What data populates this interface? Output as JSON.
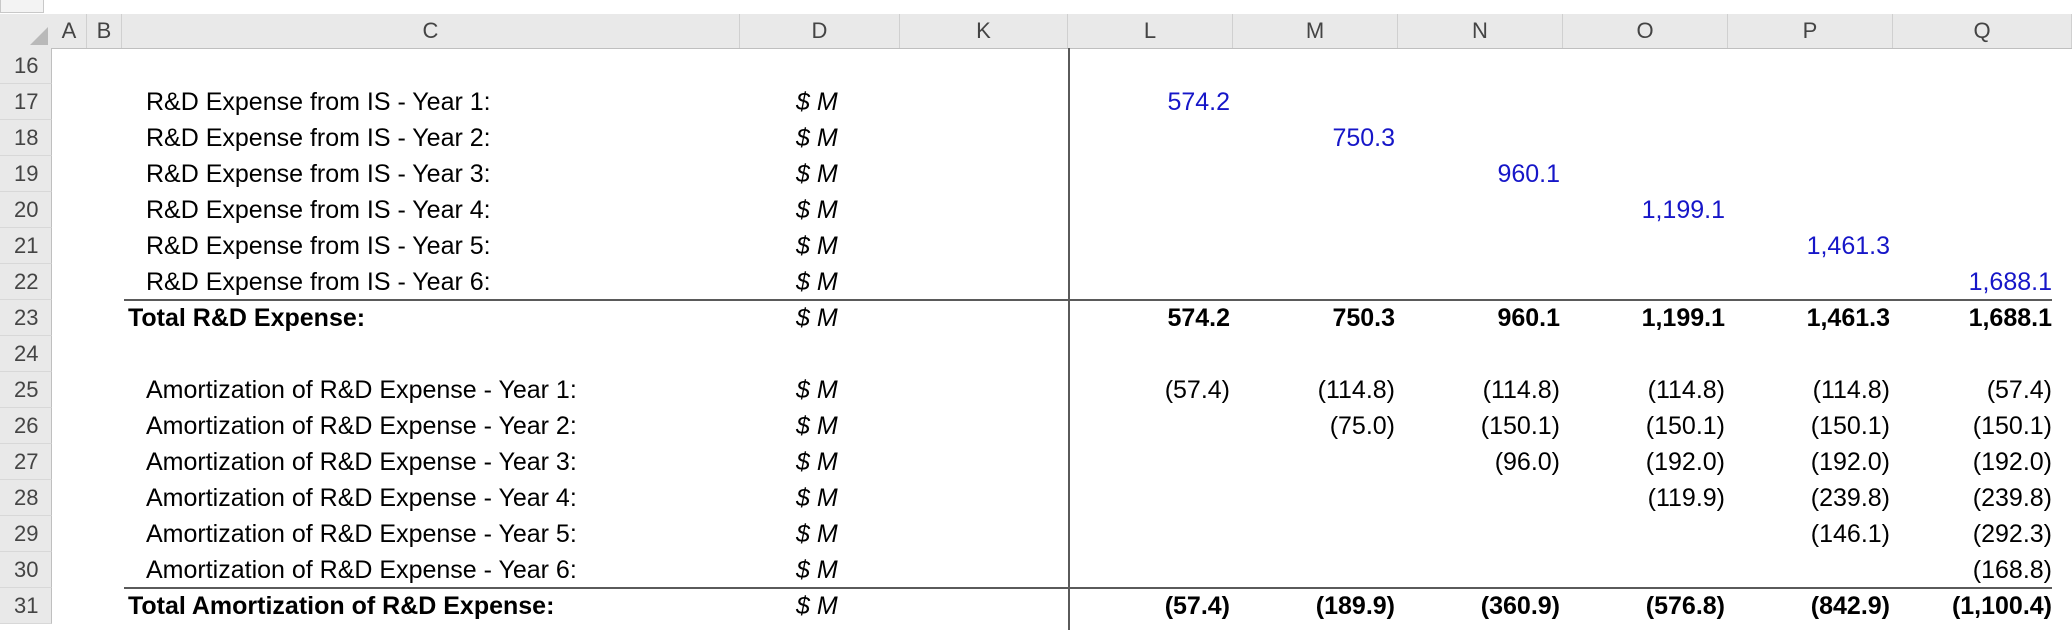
{
  "columns": [
    "A",
    "B",
    "C",
    "D",
    "K",
    "L",
    "M",
    "N",
    "O",
    "P",
    "Q"
  ],
  "rows": [
    {
      "num": "16",
      "label": "",
      "unit": "",
      "values": [
        "",
        "",
        "",
        "",
        "",
        ""
      ],
      "bold": false
    },
    {
      "num": "17",
      "label": "R&D Expense from IS - Year 1:",
      "unit": "$ M",
      "values": [
        "574.2",
        "",
        "",
        "",
        "",
        ""
      ],
      "bold": false
    },
    {
      "num": "18",
      "label": "R&D Expense from IS - Year 2:",
      "unit": "$ M",
      "values": [
        "",
        "750.3",
        "",
        "",
        "",
        ""
      ],
      "bold": false
    },
    {
      "num": "19",
      "label": "R&D Expense from IS - Year 3:",
      "unit": "$ M",
      "values": [
        "",
        "",
        "960.1",
        "",
        "",
        ""
      ],
      "bold": false
    },
    {
      "num": "20",
      "label": "R&D Expense from IS - Year 4:",
      "unit": "$ M",
      "values": [
        "",
        "",
        "",
        "1,199.1",
        "",
        ""
      ],
      "bold": false
    },
    {
      "num": "21",
      "label": "R&D Expense from IS - Year 5:",
      "unit": "$ M",
      "values": [
        "",
        "",
        "",
        "",
        "1,461.3",
        ""
      ],
      "bold": false
    },
    {
      "num": "22",
      "label": "R&D Expense from IS - Year 6:",
      "unit": "$ M",
      "values": [
        "",
        "",
        "",
        "",
        "",
        "1,688.1"
      ],
      "bold": false
    },
    {
      "num": "23",
      "label": "Total R&D Expense:",
      "unit": "$ M",
      "values": [
        "574.2",
        "750.3",
        "960.1",
        "1,199.1",
        "1,461.3",
        "1,688.1"
      ],
      "bold": true
    },
    {
      "num": "24",
      "label": "",
      "unit": "",
      "values": [
        "",
        "",
        "",
        "",
        "",
        ""
      ],
      "bold": false
    },
    {
      "num": "25",
      "label": "Amortization of R&D Expense - Year 1:",
      "unit": "$ M",
      "values": [
        "(57.4)",
        "(114.8)",
        "(114.8)",
        "(114.8)",
        "(114.8)",
        "(57.4)"
      ],
      "bold": false
    },
    {
      "num": "26",
      "label": "Amortization of R&D Expense - Year 2:",
      "unit": "$ M",
      "values": [
        "",
        "(75.0)",
        "(150.1)",
        "(150.1)",
        "(150.1)",
        "(150.1)"
      ],
      "bold": false
    },
    {
      "num": "27",
      "label": "Amortization of R&D Expense - Year 3:",
      "unit": "$ M",
      "values": [
        "",
        "",
        "(96.0)",
        "(192.0)",
        "(192.0)",
        "(192.0)"
      ],
      "bold": false
    },
    {
      "num": "28",
      "label": "Amortization of R&D Expense - Year 4:",
      "unit": "$ M",
      "values": [
        "",
        "",
        "",
        "(119.9)",
        "(239.8)",
        "(239.8)"
      ],
      "bold": false
    },
    {
      "num": "29",
      "label": "Amortization of R&D Expense - Year 5:",
      "unit": "$ M",
      "values": [
        "",
        "",
        "",
        "",
        "(146.1)",
        "(292.3)"
      ],
      "bold": false
    },
    {
      "num": "30",
      "label": "Amortization of R&D Expense - Year 6:",
      "unit": "$ M",
      "values": [
        "",
        "",
        "",
        "",
        "",
        "(168.8)"
      ],
      "bold": false
    },
    {
      "num": "31",
      "label": "Total Amortization of R&D Expense:",
      "unit": "$ M",
      "values": [
        "(57.4)",
        "(189.9)",
        "(360.9)",
        "(576.8)",
        "(842.9)",
        "(1,100.4)"
      ],
      "bold": true
    }
  ],
  "colors": {
    "input_blue": "#1616c8",
    "header_bg": "#e9e9e9"
  }
}
